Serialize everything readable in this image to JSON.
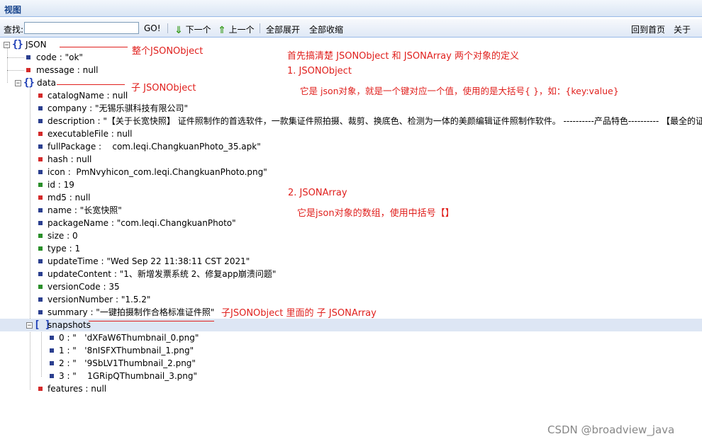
{
  "window": {
    "title": "视图"
  },
  "toolbar": {
    "search_label": "查找:",
    "search_value": "",
    "go_label": "GO!",
    "next_label": "下一个",
    "prev_label": "上一个",
    "expand_all_label": "全部展开",
    "collapse_all_label": "全部收缩",
    "home_label": "回到首页",
    "about_label": "关于"
  },
  "tree": {
    "root": "JSON",
    "code": "code : \"ok\"",
    "message": "message : null",
    "data": "data",
    "data_items": {
      "catalogName": "catalogName : null",
      "company": "company : \"无锡乐骐科技有限公司\"",
      "description": "description : \"【关于长宽快照】 证件照制作的首选软件，一款集证件照拍摄、裁剪、换底色、检测为一体的美颜编辑证件照制作软件。 ----------产品特色---------- 【最全的证件",
      "executableFile": "executableFile : null",
      "fullPackage": "fullPackage :    com.leqi.ChangkuanPhoto_35.apk\"",
      "hash": "hash : null",
      "icon": "icon :  PmNvyhicon_com.leqi.ChangkuanPhoto.png\"",
      "id": "id : 19",
      "md5": "md5 : null",
      "name": "name : \"长宽快照\"",
      "packageName": "packageName : \"com.leqi.ChangkuanPhoto\"",
      "size": "size : 0",
      "type": "type : 1",
      "updateTime": "updateTime : \"Wed Sep 22 11:38:11 CST 2021\"",
      "updateContent": "updateContent : \"1、新增发票系统 2、修复app崩溃问题\"",
      "versionCode": "versionCode : 35",
      "versionNumber": "versionNumber : \"1.5.2\"",
      "summary": "summary : \"一键拍摄制作合格标准证件照\"",
      "snapshots": "snapshots",
      "features": "features : null"
    },
    "snapshot_items": [
      "0 : \"   'dXFaW6Thumbnail_0.png\"",
      "1 : \"   '8nISFXThumbnail_1.png\"",
      "2 : \"   '9SbLV1Thumbnail_2.png\"",
      "3 : \"    1GRipQThumbnail_3.png\""
    ]
  },
  "annotations": {
    "whole_object": "整个JSONObject",
    "sub_object": "子 JSONObject",
    "sub_array": "子JSONObject 里面的 子 JSONArray",
    "intro": "首先搞清楚 JSONObject 和 JSONArray 两个对象的定义",
    "point1_title": "1. JSONObject",
    "point1_desc": "它是 json对象，就是一个键对应一个值，使用的是大括号{ }，如：{key:value}",
    "point2_title": "2. JSONArray",
    "point2_desc": "它是json对象的数组，使用中括号【】"
  },
  "watermark": "CSDN @broadview_java",
  "colors": {
    "annotation": "#e0201d",
    "key_leaf_red": "#d42a2a",
    "key_leaf_blue": "#2b3f8f",
    "key_leaf_green": "#2a8f2a",
    "title_text": "#15428b",
    "highlight_row": "#dde6f4"
  }
}
